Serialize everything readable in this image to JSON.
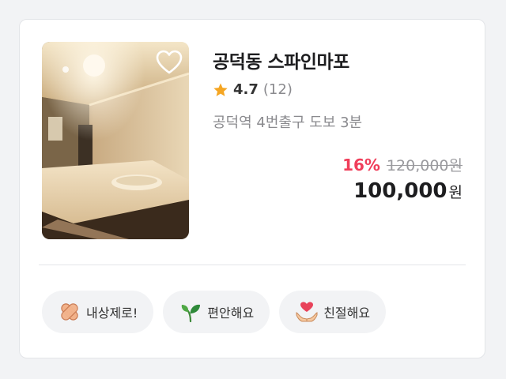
{
  "listing": {
    "title": "공덕동 스파인마포",
    "rating": "4.7",
    "review_count": "(12)",
    "location": "공덕역 4번출구 도보 3분",
    "discount": "16%",
    "original_price": "120,000원",
    "final_price": "100,000",
    "currency": "원",
    "favorited": false
  },
  "tags": [
    {
      "label": "내상제로!",
      "icon": "bandage-icon"
    },
    {
      "label": "편안해요",
      "icon": "sprout-icon"
    },
    {
      "label": "친절해요",
      "icon": "heart-hands-icon"
    }
  ],
  "colors": {
    "discount": "#f03e5a",
    "star": "#f5a623",
    "muted": "#8a8a8e"
  }
}
